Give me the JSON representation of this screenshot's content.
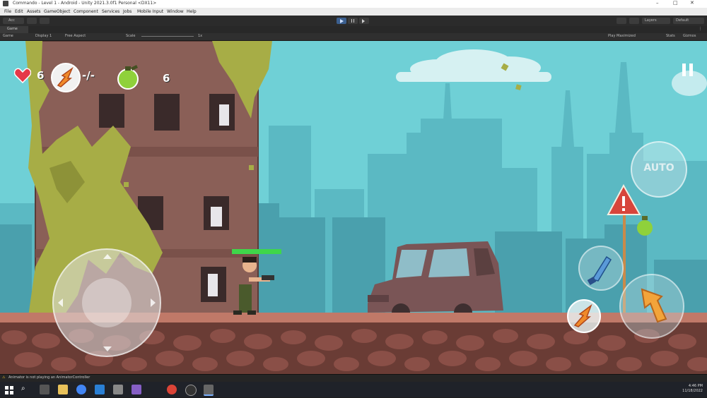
{
  "window": {
    "title": "Commando - Level 1 - Android - Unity 2021.3.0f1 Personal <DX11>",
    "controls": [
      "–",
      "□",
      "✕"
    ]
  },
  "menu": [
    "File",
    "Edit",
    "Assets",
    "GameObject",
    "Component",
    "Services",
    "Jobs",
    "Mobile Input",
    "Window",
    "Help"
  ],
  "toolbar": {
    "account": "Acc",
    "layers": "Layers",
    "layout": "Default"
  },
  "tabs": {
    "game": "Game"
  },
  "gamebar": {
    "display": "Display 1",
    "aspect": "Free Aspect",
    "scale_label": "Scale",
    "scale_value": "1x",
    "play_mode": "Play Maximized",
    "stats": "Stats",
    "gizmos": "Gizmos"
  },
  "hud": {
    "lives": "6",
    "special_ammo": "-/-",
    "grenades": "6",
    "auto_label": "AUTO"
  },
  "colors": {
    "sky": "#6fd0d6",
    "health_bar": "#3fd64a",
    "ground": "#b66a58"
  },
  "status": {
    "message": "Animator is not playing an AnimatorController"
  },
  "clock": {
    "time": "4:46 PM",
    "date": "11/18/2022"
  }
}
